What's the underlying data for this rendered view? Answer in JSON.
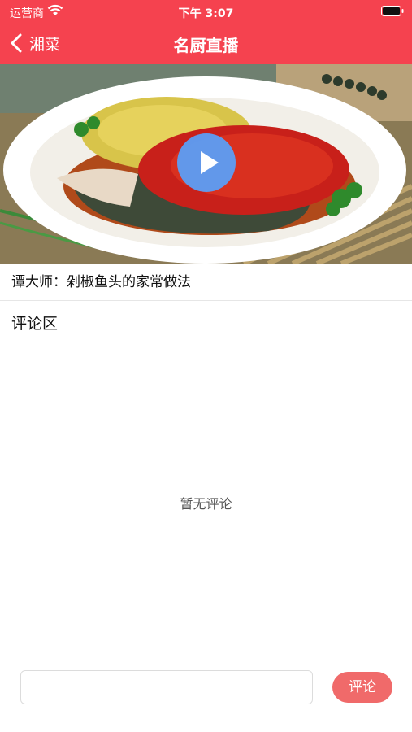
{
  "status_bar": {
    "carrier": "运营商",
    "time": "下午 3:07"
  },
  "nav": {
    "back_label": "湘菜",
    "title": "名厨直播"
  },
  "video": {
    "title": "谭大师：剁椒鱼头的家常做法"
  },
  "comments": {
    "heading": "评论区",
    "empty_text": "暂无评论"
  },
  "input": {
    "value": "",
    "placeholder": "",
    "submit_label": "评论"
  },
  "colors": {
    "nav_background": "#f5424f",
    "play_button": "#5c9ef5",
    "comment_button": "#f06a6a"
  },
  "icons": {
    "back": "chevron-left-icon",
    "play": "play-icon",
    "wifi": "wifi-icon",
    "battery": "battery-icon"
  }
}
